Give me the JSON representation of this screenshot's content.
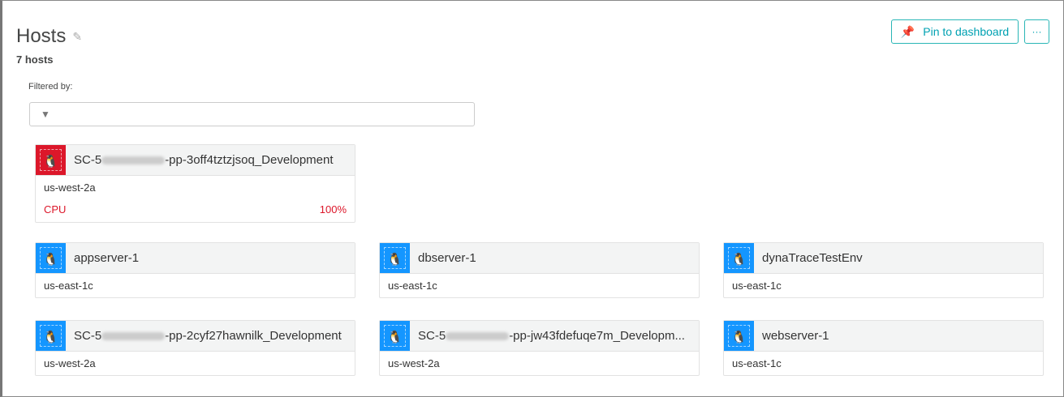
{
  "header": {
    "title": "Hosts",
    "count": "7 hosts",
    "pin_label": "Pin to dashboard",
    "more_label": "···"
  },
  "filter": {
    "label": "Filtered by:",
    "placeholder": ""
  },
  "colors": {
    "critical": "#dc172a",
    "normal": "#1496ff",
    "accent": "#00a1b2"
  },
  "hosts": [
    {
      "prefix": "SC-5",
      "suffix": "-pp-3off4tztzjsoq_Development",
      "zone": "us-west-2a",
      "status": "critical",
      "metric_label": "CPU",
      "metric_value": "100%"
    },
    {
      "prefix": "appserver-1",
      "suffix": "",
      "zone": "us-east-1c",
      "status": "normal"
    },
    {
      "prefix": "dbserver-1",
      "suffix": "",
      "zone": "us-east-1c",
      "status": "normal"
    },
    {
      "prefix": "dynaTraceTestEnv",
      "suffix": "",
      "zone": "us-east-1c",
      "status": "normal"
    },
    {
      "prefix": "SC-5",
      "suffix": "-pp-2cyf27hawnilk_Development",
      "zone": "us-west-2a",
      "status": "normal"
    },
    {
      "prefix": "SC-5",
      "suffix": "-pp-jw43fdefuqe7m_Developm...",
      "zone": "us-west-2a",
      "status": "normal"
    },
    {
      "prefix": "webserver-1",
      "suffix": "",
      "zone": "us-east-1c",
      "status": "normal"
    }
  ]
}
